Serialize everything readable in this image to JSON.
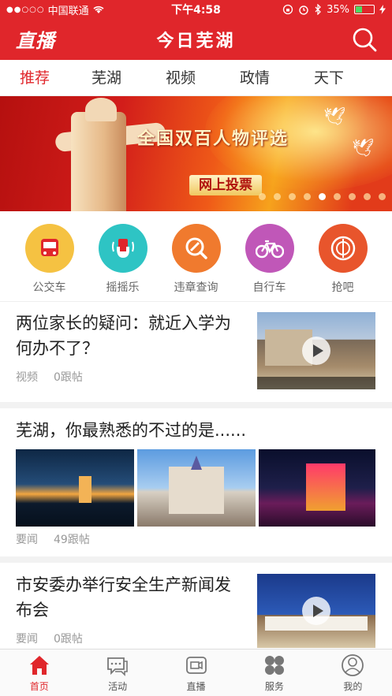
{
  "status_bar": {
    "signal": "●●○○○",
    "carrier": "中国联通",
    "time": "下午4:58",
    "battery": "35%",
    "battery_level": 0.35
  },
  "header": {
    "logo": "直播",
    "title": "今日芜湖"
  },
  "tabs": [
    {
      "label": "推荐",
      "active": true
    },
    {
      "label": "芜湖",
      "active": false
    },
    {
      "label": "视频",
      "active": false
    },
    {
      "label": "政情",
      "active": false
    },
    {
      "label": "天下",
      "active": false
    }
  ],
  "banner": {
    "headline": "全国双百人物评选",
    "button": "网上投票",
    "slide_count": 9,
    "active_slide": 4
  },
  "quick_links": [
    {
      "label": "公交车",
      "icon": "bus-icon",
      "color": "#f5c242"
    },
    {
      "label": "摇摇乐",
      "icon": "shake-hand-icon",
      "color": "#2ec4c4"
    },
    {
      "label": "违章查询",
      "icon": "search-violation-icon",
      "color": "#f07a2e"
    },
    {
      "label": "自行车",
      "icon": "bicycle-icon",
      "color": "#c057b8"
    },
    {
      "label": "抢吧",
      "icon": "grab-icon",
      "color": "#e8552c"
    }
  ],
  "news": [
    {
      "title": "两位家长的疑问：就近入学为何办不了？",
      "category": "视频",
      "comments": "0跟帖"
    },
    {
      "title": "芜湖，你最熟悉的不过的是......",
      "category": "要闻",
      "comments": "49跟帖"
    },
    {
      "title": "市安委办举行安全生产新闻发布会",
      "category": "要闻",
      "comments": "0跟帖"
    }
  ],
  "bottom_nav": [
    {
      "label": "首页",
      "icon": "home-icon",
      "active": true
    },
    {
      "label": "活动",
      "icon": "chat-icon",
      "active": false
    },
    {
      "label": "直播",
      "icon": "live-video-icon",
      "active": false
    },
    {
      "label": "服务",
      "icon": "grid-icon",
      "active": false
    },
    {
      "label": "我的",
      "icon": "profile-icon",
      "active": false
    }
  ],
  "colors": {
    "brand": "#e0262b"
  }
}
